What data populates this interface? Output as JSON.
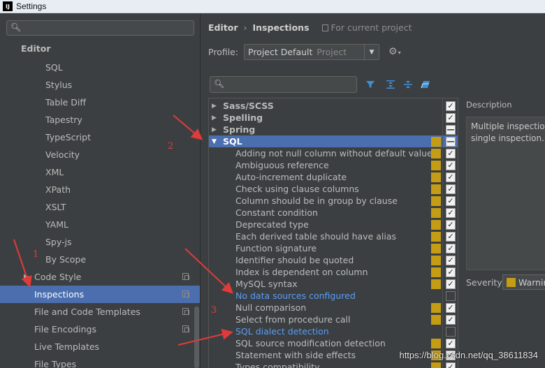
{
  "window": {
    "title": "Settings",
    "app_icon": "intellij-icon"
  },
  "sidebar": {
    "search": {
      "value": "",
      "icon": "search-icon"
    },
    "group_label": "Editor",
    "items": [
      {
        "label": "SQL",
        "indent": 2
      },
      {
        "label": "Stylus",
        "indent": 2
      },
      {
        "label": "Table Diff",
        "indent": 2
      },
      {
        "label": "Tapestry",
        "indent": 2
      },
      {
        "label": "TypeScript",
        "indent": 2
      },
      {
        "label": "Velocity",
        "indent": 2
      },
      {
        "label": "XML",
        "indent": 2
      },
      {
        "label": "XPath",
        "indent": 2
      },
      {
        "label": "XSLT",
        "indent": 2
      },
      {
        "label": "YAML",
        "indent": 2
      },
      {
        "label": "Spy-js",
        "indent": 2
      },
      {
        "label": "By Scope",
        "indent": 2
      },
      {
        "label": "Code Style",
        "indent": 1,
        "expandable": true,
        "copy_icon": true
      },
      {
        "label": "Inspections",
        "indent": 1,
        "selected": true,
        "copy_icon": true
      },
      {
        "label": "File and Code Templates",
        "indent": 1,
        "copy_icon": true
      },
      {
        "label": "File Encodings",
        "indent": 1,
        "copy_icon": true
      },
      {
        "label": "Live Templates",
        "indent": 1
      },
      {
        "label": "File Types",
        "indent": 1
      }
    ]
  },
  "main": {
    "breadcrumb": {
      "parent": "Editor",
      "separator": "›",
      "current": "Inspections",
      "scope": "For current project"
    },
    "profile": {
      "label": "Profile:",
      "value": "Project Default",
      "scope": "Project"
    },
    "search": {
      "value": ""
    },
    "toolbar": {
      "filter_icon": "filter-icon",
      "expand_icon": "expand-all-icon",
      "collapse_icon": "collapse-all-icon",
      "reset_icon": "eraser-icon"
    },
    "inspections": [
      {
        "label": "Sass/SCSS",
        "group": true,
        "collapsed": true,
        "checked": true
      },
      {
        "label": "Spelling",
        "group": true,
        "collapsed": true,
        "checked": true
      },
      {
        "label": "Spring",
        "group": true,
        "collapsed": true,
        "checked": "partial"
      },
      {
        "label": "SQL",
        "group": true,
        "collapsed": false,
        "selected": true,
        "checked": "partial",
        "severity": true
      },
      {
        "label": "Adding not null column without default value",
        "checked": true,
        "severity": true
      },
      {
        "label": "Ambiguous reference",
        "checked": true,
        "severity": true
      },
      {
        "label": "Auto-increment duplicate",
        "checked": true,
        "severity": true
      },
      {
        "label": "Check using clause columns",
        "checked": true,
        "severity": true
      },
      {
        "label": "Column should be in group by clause",
        "checked": true,
        "severity": true
      },
      {
        "label": "Constant condition",
        "checked": true,
        "severity": true
      },
      {
        "label": "Deprecated type",
        "checked": true,
        "severity": true
      },
      {
        "label": "Each derived table should have alias",
        "checked": true,
        "severity": true
      },
      {
        "label": "Function signature",
        "checked": true,
        "severity": true
      },
      {
        "label": "Identifier should be quoted",
        "checked": true,
        "severity": true
      },
      {
        "label": "Index is dependent on column",
        "checked": true,
        "severity": true
      },
      {
        "label": "MySQL syntax",
        "checked": true,
        "severity": true
      },
      {
        "label": "No data sources configured",
        "checked": false,
        "link": true
      },
      {
        "label": "Null comparison",
        "checked": true,
        "severity": true
      },
      {
        "label": "Select from procedure call",
        "checked": true,
        "severity": true
      },
      {
        "label": "SQL dialect detection",
        "checked": false,
        "link": true
      },
      {
        "label": "SQL source modification detection",
        "checked": true,
        "severity": true
      },
      {
        "label": "Statement with side effects",
        "checked": true,
        "severity": true
      },
      {
        "label": "Types compatibility",
        "checked": true,
        "severity": true
      }
    ],
    "description": {
      "label": "Description",
      "line1": "Multiple inspection",
      "line2": "single inspection."
    },
    "severity": {
      "label": "Severity:",
      "value": "Warnin"
    }
  },
  "annotations": {
    "num1": "1",
    "num2": "2",
    "num3": "3"
  },
  "watermark": "https://blog.csdn.net/qq_38611834",
  "colors": {
    "selection": "#4b6eaf",
    "severity_warning": "#c59d15",
    "link": "#589df6",
    "annotation": "#e03b3b"
  }
}
